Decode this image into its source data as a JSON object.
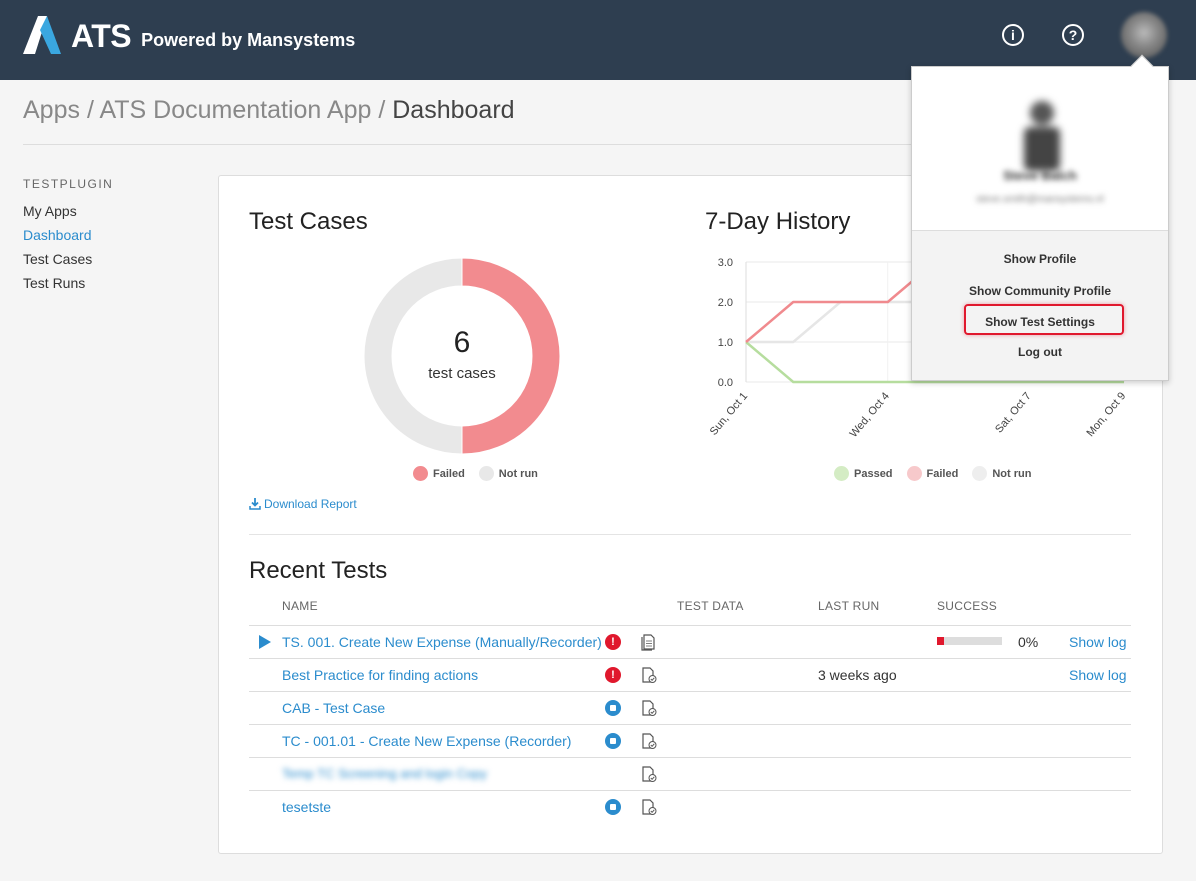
{
  "header": {
    "logo_text": "ATS",
    "logo_sub": "Powered by Mansystems",
    "info_icon": "info-icon",
    "help_icon": "help-icon",
    "colors": {
      "bar": "#2e3e50",
      "accent": "#2b8ccd",
      "danger": "#e0182d"
    }
  },
  "breadcrumb": {
    "items": [
      "Apps",
      "ATS Documentation App",
      "Dashboard"
    ],
    "sep": "/"
  },
  "sidebar": {
    "heading": "TESTPLUGIN",
    "items": [
      {
        "label": "My Apps",
        "active": false
      },
      {
        "label": "Dashboard",
        "active": true
      },
      {
        "label": "Test Cases",
        "active": false
      },
      {
        "label": "Test Runs",
        "active": false
      }
    ]
  },
  "test_cases": {
    "title": "Test Cases",
    "count": "6",
    "count_label": "test cases",
    "legend": [
      {
        "label": "Failed",
        "color": "#f28b8f"
      },
      {
        "label": "Not run",
        "color": "#e8e8e8"
      }
    ],
    "download": "Download Report"
  },
  "history": {
    "title": "7-Day History",
    "legend": [
      {
        "label": "Passed",
        "color": "#d4ecc4"
      },
      {
        "label": "Failed",
        "color": "#f7c9cb"
      },
      {
        "label": "Not run",
        "color": "#eeeeee"
      }
    ]
  },
  "chart_data": [
    {
      "type": "pie",
      "title": "Test Cases",
      "categories": [
        "Failed",
        "Not run"
      ],
      "values": [
        3,
        3
      ],
      "center_value": 6,
      "center_label": "test cases"
    },
    {
      "type": "line",
      "title": "7-Day History",
      "x": [
        "Sun, Oct 1",
        "Mon, Oct 2",
        "Tue, Oct 3",
        "Wed, Oct 4",
        "Thu, Oct 5",
        "Fri, Oct 6",
        "Sat, Oct 7",
        "Sun, Oct 8",
        "Mon, Oct 9"
      ],
      "x_tick_labels": [
        "Sun, Oct 1",
        "Wed, Oct 4",
        "Sat, Oct 7",
        "Mon, Oct 9"
      ],
      "ylim": [
        0,
        3
      ],
      "yticks": [
        "0.0",
        "1.0",
        "2.0",
        "3.0"
      ],
      "series": [
        {
          "name": "Passed",
          "color": "#b6dd9e",
          "values": [
            1,
            0,
            0,
            0,
            0,
            0,
            0,
            0,
            0
          ]
        },
        {
          "name": "Failed",
          "color": "#f08a8e",
          "values": [
            1,
            2,
            2,
            2,
            3,
            3,
            3,
            3,
            3
          ]
        },
        {
          "name": "Not run",
          "color": "#e6e6e6",
          "values": [
            1,
            1,
            2,
            2,
            2,
            2,
            2,
            2,
            2
          ]
        }
      ]
    }
  ],
  "recent_tests": {
    "title": "Recent Tests",
    "columns": [
      "NAME",
      "TEST DATA",
      "LAST RUN",
      "SUCCESS"
    ],
    "rows": [
      {
        "name": "TS. 001. Create New Expense (Manually/Recorder)",
        "status": "error",
        "last_run": "",
        "success": "0%",
        "success_fraction": 0.1,
        "show_log": "Show log",
        "playable": true
      },
      {
        "name": "Best Practice for finding actions",
        "status": "error",
        "last_run": "3 weeks ago",
        "success": "",
        "show_log": "Show log",
        "playable": false
      },
      {
        "name": "CAB - Test Case",
        "status": "stopped",
        "last_run": "",
        "success": "",
        "show_log": "",
        "playable": false
      },
      {
        "name": "TC - 001.01 - Create New Expense (Recorder)",
        "status": "stopped",
        "last_run": "",
        "success": "",
        "show_log": "",
        "playable": false
      },
      {
        "name": "Temp TC Screening and login Copy",
        "status": "none",
        "last_run": "",
        "success": "",
        "show_log": "",
        "playable": false,
        "blurred": true
      },
      {
        "name": "tesetste",
        "status": "stopped",
        "last_run": "",
        "success": "",
        "show_log": "",
        "playable": false
      }
    ]
  },
  "user_menu": {
    "name": "Steve Balch",
    "email": "steve.smith@mansystems.nl",
    "items": [
      "Show Profile",
      "Show Community Profile",
      "Show Test Settings",
      "Log out"
    ],
    "highlighted": "Show Test Settings"
  }
}
